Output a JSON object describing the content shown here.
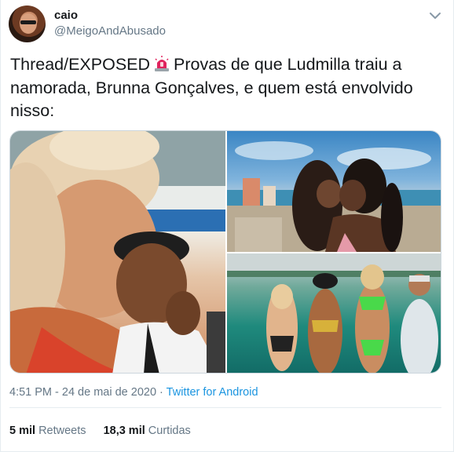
{
  "user": {
    "name": "caio",
    "handle": "@MeigoAndAbusado"
  },
  "tweet": {
    "text_before": "Thread/EXPOSED",
    "text_after": "Provas de que Ludmilla traiu a namorada, Brunna Gonçalves, e quem está envolvido nisso:",
    "emoji_icon": "police-siren-icon"
  },
  "media": {
    "count": 3,
    "images": [
      "photo-selfie",
      "photo-kiss-beach",
      "photo-boat-group"
    ]
  },
  "meta": {
    "time": "4:51 PM",
    "separator": "·",
    "date": "24 de mai de 2020",
    "source": "Twitter for Android"
  },
  "stats": {
    "retweets_count": "5 mil",
    "retweets_label": "Retweets",
    "likes_count": "18,3 mil",
    "likes_label": "Curtidas"
  },
  "colors": {
    "link": "#1b95e0",
    "secondary_text": "#657786",
    "divider": "#e6ecf0"
  }
}
